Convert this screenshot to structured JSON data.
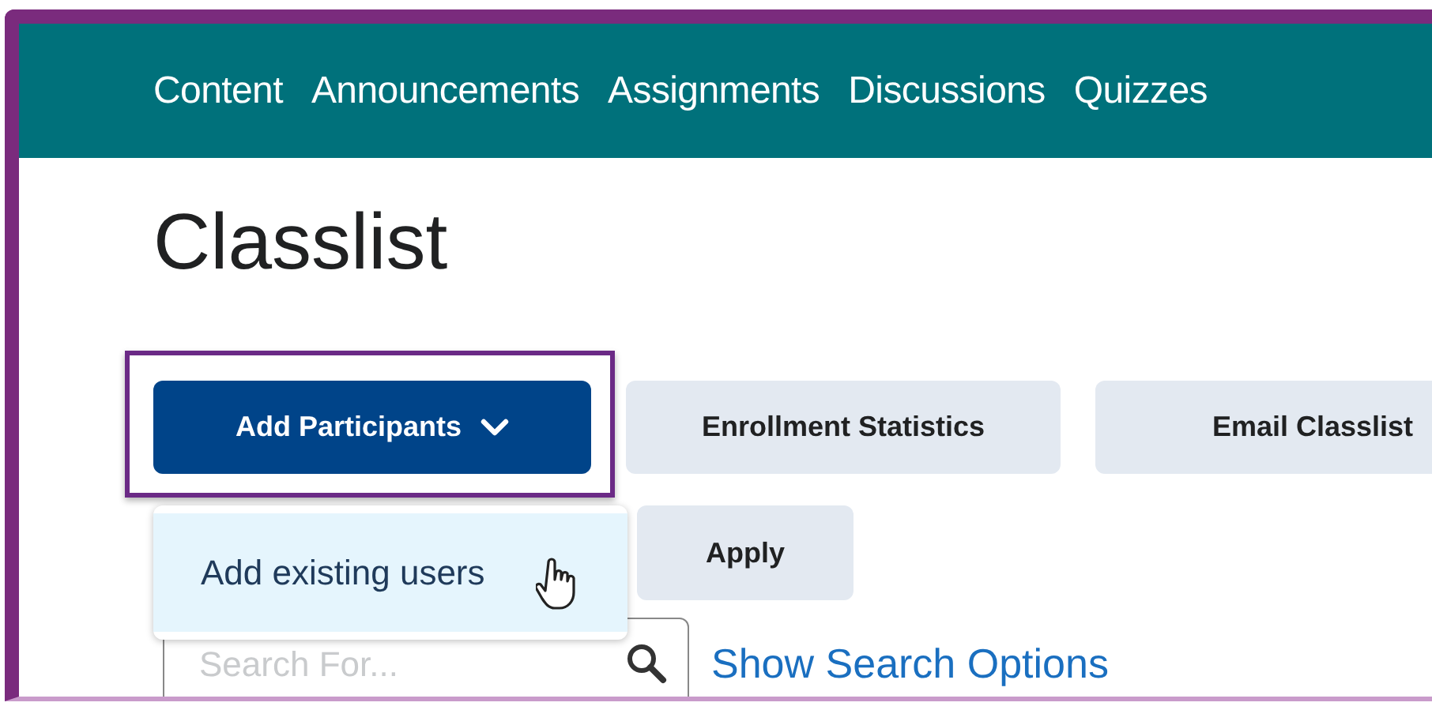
{
  "nav": {
    "items": [
      {
        "label": "Content"
      },
      {
        "label": "Announcements"
      },
      {
        "label": "Assignments"
      },
      {
        "label": "Discussions"
      },
      {
        "label": "Quizzes"
      }
    ]
  },
  "page_title": "Classlist",
  "toolbar": [
    {
      "label": "Add Participants",
      "kind": "primary",
      "highlighted": true
    },
    {
      "label": "Enrollment Statistics",
      "kind": "secondary",
      "highlighted": false
    },
    {
      "label": "Email Classlist",
      "kind": "secondary",
      "highlighted": false
    }
  ],
  "menu": {
    "items": [
      {
        "label": "Add existing users",
        "hovered": true
      }
    ]
  },
  "apply_button": {
    "label": "Apply"
  },
  "search": {
    "placeholder": "Search For..."
  },
  "search_options_link": {
    "label": "Show Search Options"
  }
}
